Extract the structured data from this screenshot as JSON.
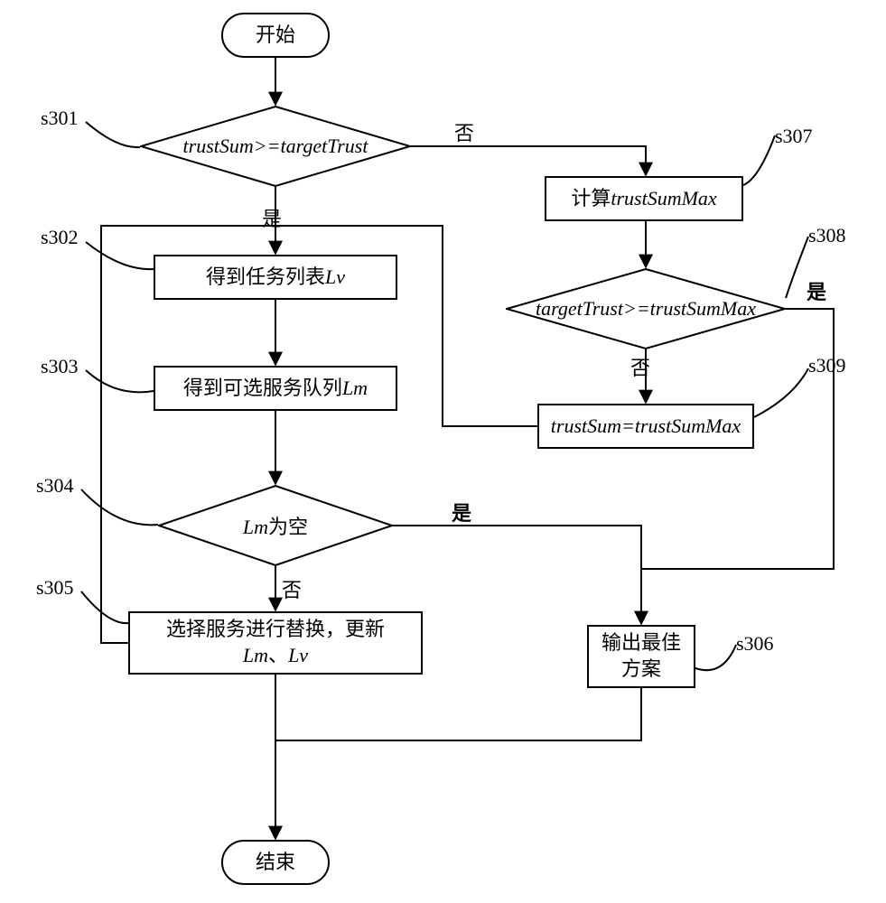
{
  "terminators": {
    "start": "开始",
    "end": "结束"
  },
  "decisions": {
    "d1": "trustSum>=targetTrust",
    "d2": "targetTrust>=trustSumMax",
    "d3_prefix": "Lm",
    "d3_suffix": "为空"
  },
  "processes": {
    "p302_prefix": "得到任务列表",
    "p302_var": "Lv",
    "p303_prefix": "得到可选服务队列",
    "p303_var": "Lm",
    "p305_line1": "选择服务进行替换，更新",
    "p305_var1": "Lm",
    "p305_sep": "、",
    "p305_var2": "Lv",
    "p306_line1": "输出最佳",
    "p306_line2": "方案",
    "p307_prefix": "计算",
    "p307_var": "trustSumMax",
    "p309": "trustSum=trustSumMax"
  },
  "edge_labels": {
    "yes": "是",
    "no": "否",
    "yes_bold": "是"
  },
  "refs": {
    "s301": "s301",
    "s302": "s302",
    "s303": "s303",
    "s304": "s304",
    "s305": "s305",
    "s306": "s306",
    "s307": "s307",
    "s308": "s308",
    "s309": "s309"
  }
}
